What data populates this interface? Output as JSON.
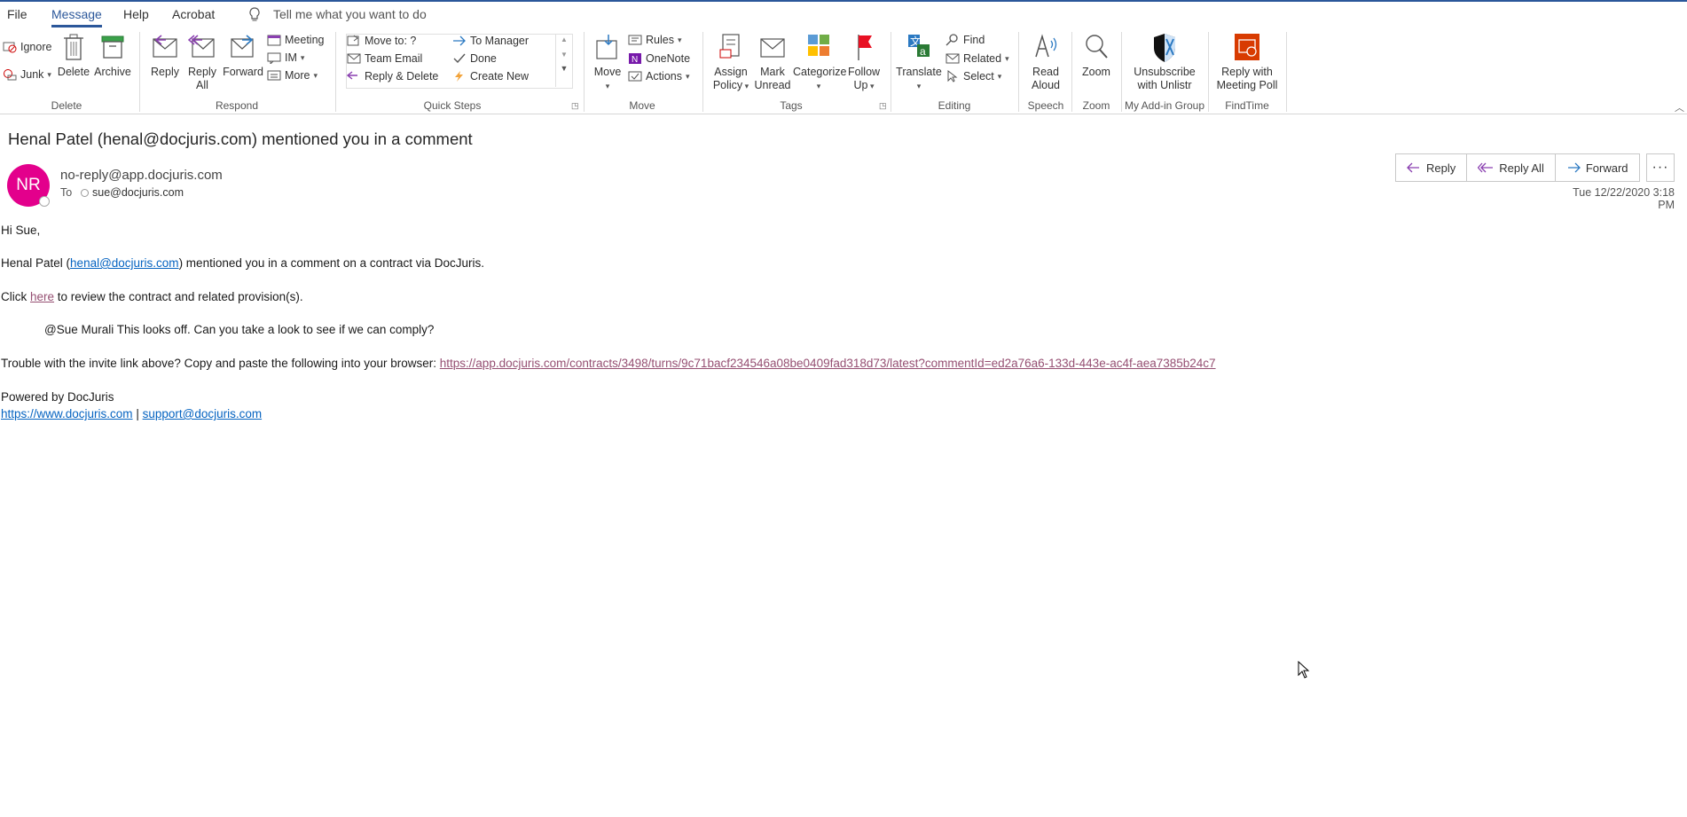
{
  "menu": {
    "items": [
      "File",
      "Message",
      "Help",
      "Acrobat"
    ],
    "active": "Message",
    "tell_me": "Tell me what you want to do"
  },
  "ribbon": {
    "delete_group": {
      "label": "Delete",
      "ignore": "Ignore",
      "junk": "Junk",
      "delete": "Delete",
      "archive": "Archive"
    },
    "respond_group": {
      "label": "Respond",
      "reply": "Reply",
      "reply_all_1": "Reply",
      "reply_all_2": "All",
      "forward": "Forward",
      "meeting": "Meeting",
      "im": "IM",
      "more": "More"
    },
    "quicksteps_group": {
      "label": "Quick Steps",
      "move_to": "Move to: ?",
      "team_email": "Team Email",
      "reply_delete": "Reply & Delete",
      "to_manager": "To Manager",
      "done": "Done",
      "create_new": "Create New"
    },
    "move_group": {
      "label": "Move",
      "move": "Move",
      "rules": "Rules",
      "onenote": "OneNote",
      "actions": "Actions"
    },
    "tags_group": {
      "label": "Tags",
      "assign_1": "Assign",
      "assign_2": "Policy",
      "mark_1": "Mark",
      "mark_2": "Unread",
      "categorize": "Categorize",
      "follow_1": "Follow",
      "follow_2": "Up"
    },
    "editing_group": {
      "label": "Editing",
      "translate": "Translate",
      "find": "Find",
      "related": "Related",
      "select": "Select"
    },
    "speech_group": {
      "label": "Speech",
      "read_1": "Read",
      "read_2": "Aloud"
    },
    "zoom_group": {
      "label": "Zoom",
      "zoom": "Zoom"
    },
    "addin_group": {
      "label": "My Add-in Group",
      "unsub_1": "Unsubscribe",
      "unsub_2": "with Unlistr"
    },
    "findtime_group": {
      "label": "FindTime",
      "reply_1": "Reply with",
      "reply_2": "Meeting Poll"
    }
  },
  "message": {
    "subject": "Henal Patel (henal@docjuris.com) mentioned you in a comment",
    "avatar_initials": "NR",
    "from": "no-reply@app.docjuris.com",
    "to_label": "To",
    "to": "sue@docjuris.com",
    "date": "Tue 12/22/2020 3:18 PM",
    "actions": {
      "reply": "Reply",
      "reply_all": "Reply All",
      "forward": "Forward",
      "more": "···"
    }
  },
  "body": {
    "greeting": "Hi Sue,",
    "line1_pre": "Henal Patel (",
    "line1_link": "henal@docjuris.com",
    "line1_post": ") mentioned you in a comment on a contract via DocJuris.",
    "line2_pre": "Click ",
    "line2_link": "here",
    "line2_post": " to review the contract and related provision(s).",
    "comment": "@Sue Murali This looks off. Can you take a look to see if we can comply?",
    "trouble_pre": "Trouble with the invite link above? Copy and paste the following into your browser: ",
    "trouble_link": "https://app.docjuris.com/contracts/3498/turns/9c71bacf234546a08be0409fad318d73/latest?commentId=ed2a76a6-133d-443e-ac4f-aea7385b24c7",
    "powered": "Powered by DocJuris",
    "site_link": "https://www.docjuris.com",
    "sep": "|",
    "support_link": "support@docjuris.com"
  },
  "colors": {
    "accent": "#2b579a",
    "avatar": "#e3008c",
    "link": "#0563c1",
    "visited_link": "#954f72"
  }
}
